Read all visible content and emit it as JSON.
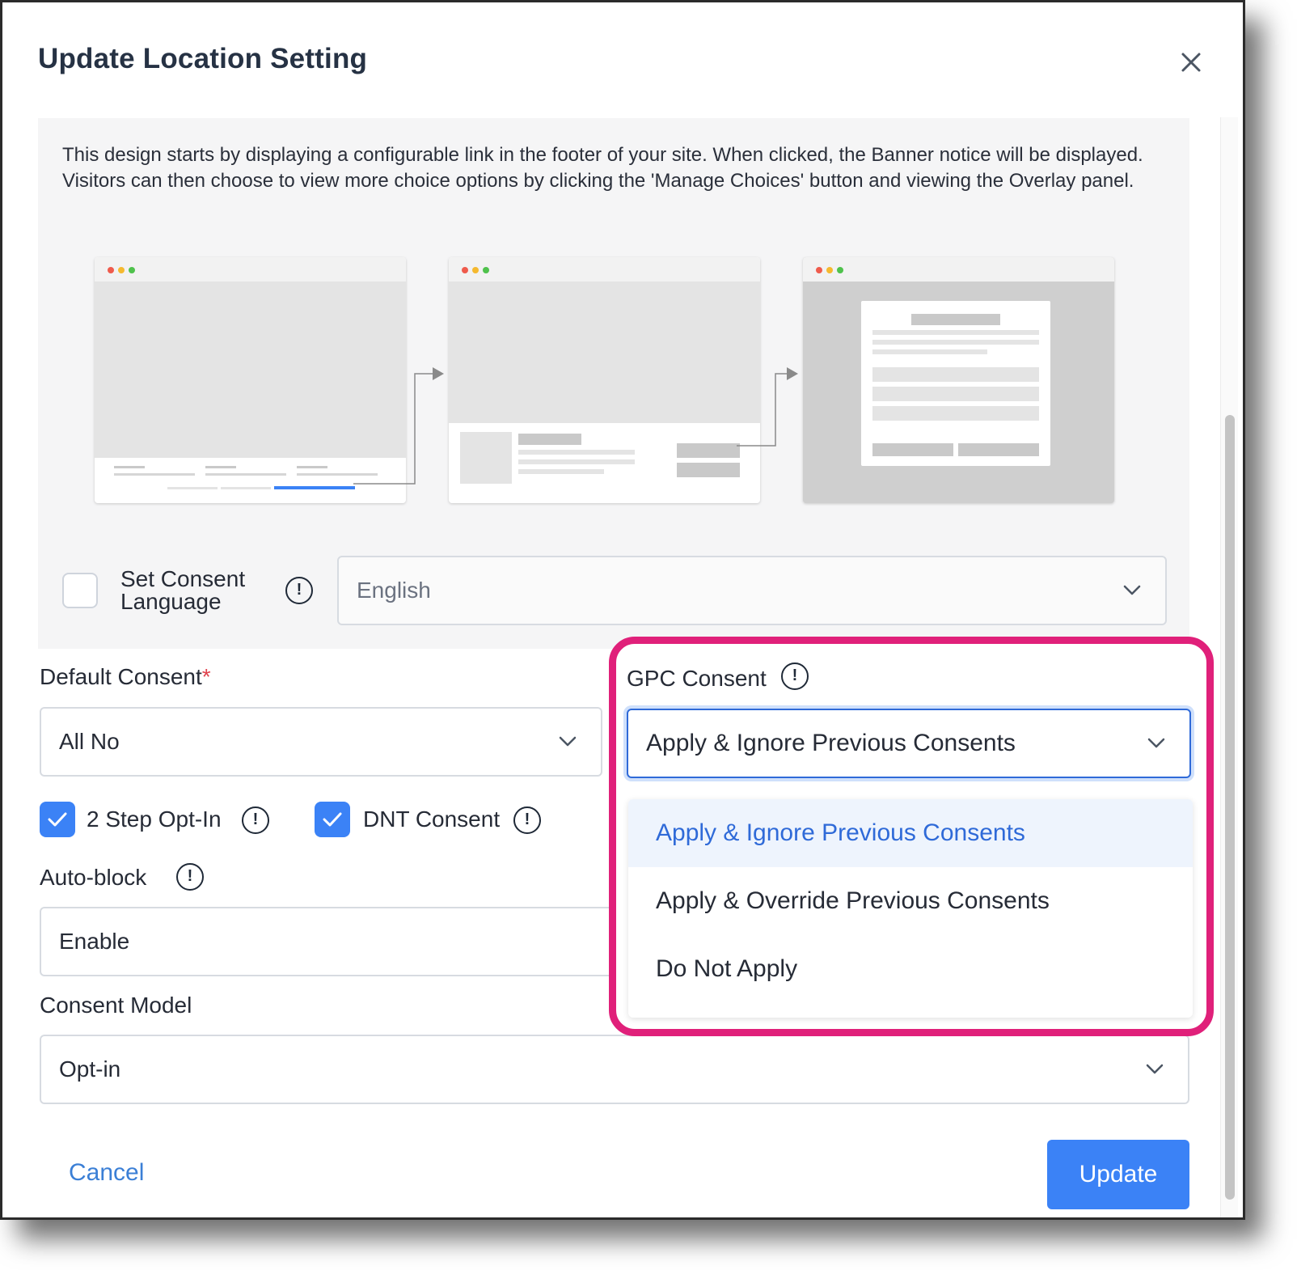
{
  "modal": {
    "title": "Update Location Setting"
  },
  "info": {
    "description": "This design starts by displaying a configurable link in the footer of your site. When clicked, the Banner notice will be displayed. Visitors can then choose to view more choice options by clicking the 'Manage Choices' button and viewing the Overlay panel."
  },
  "consent_language": {
    "label": "Set Consent Language",
    "checked": false,
    "value": "English"
  },
  "default_consent": {
    "label": "Default Consent",
    "required_mark": "*",
    "value": "All No"
  },
  "two_step": {
    "label": "2 Step Opt-In",
    "checked": true
  },
  "dnt": {
    "label": "DNT Consent",
    "checked": true
  },
  "auto_block": {
    "label": "Auto-block",
    "value": "Enable"
  },
  "consent_model": {
    "label": "Consent Model",
    "value": "Opt-in"
  },
  "gpc": {
    "label": "GPC Consent",
    "value": "Apply & Ignore Previous Consents",
    "options": [
      {
        "label": "Apply & Ignore Previous Consents",
        "selected": true
      },
      {
        "label": "Apply & Override Previous Consents",
        "selected": false
      },
      {
        "label": "Do Not Apply",
        "selected": false
      }
    ]
  },
  "footer": {
    "cancel": "Cancel",
    "update": "Update"
  },
  "colors": {
    "accent": "#3b82f6",
    "highlight": "#e0207a",
    "link": "#3b7fd6"
  }
}
